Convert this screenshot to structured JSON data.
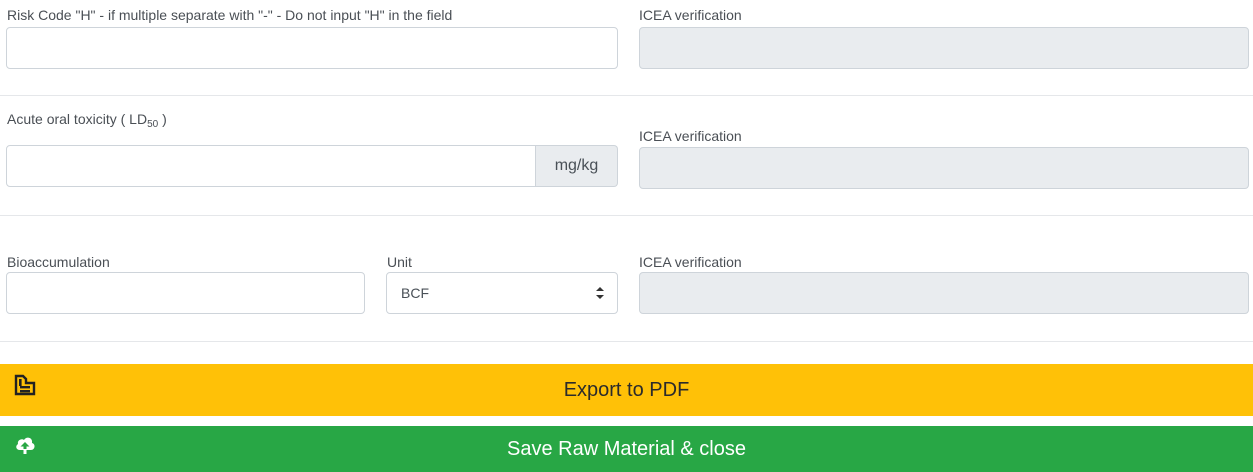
{
  "row1": {
    "risk_label": "Risk Code \"H\" - if multiple separate with \"-\" - Do not input \"H\" in the field",
    "risk_value": "",
    "icea_label": "ICEA verification",
    "icea_value": ""
  },
  "row2": {
    "oral_label_prefix": "Acute oral toxicity ( LD",
    "oral_label_sub": "50",
    "oral_label_suffix": " )",
    "oral_value": "",
    "oral_unit": "mg/kg",
    "icea_label": "ICEA verification",
    "icea_value": ""
  },
  "row3": {
    "bio_label": "Bioaccumulation",
    "bio_value": "",
    "unit_label": "Unit",
    "unit_selected": "BCF",
    "icea_label": "ICEA verification",
    "icea_value": ""
  },
  "buttons": {
    "export_label": "Export to PDF",
    "export_icon": "pdf-file-icon",
    "save_label": "Save Raw Material & close",
    "save_icon": "cloud-upload-icon"
  },
  "colors": {
    "export_bg": "#ffc107",
    "save_bg": "#28a745",
    "readonly_bg": "#e9ecef"
  }
}
